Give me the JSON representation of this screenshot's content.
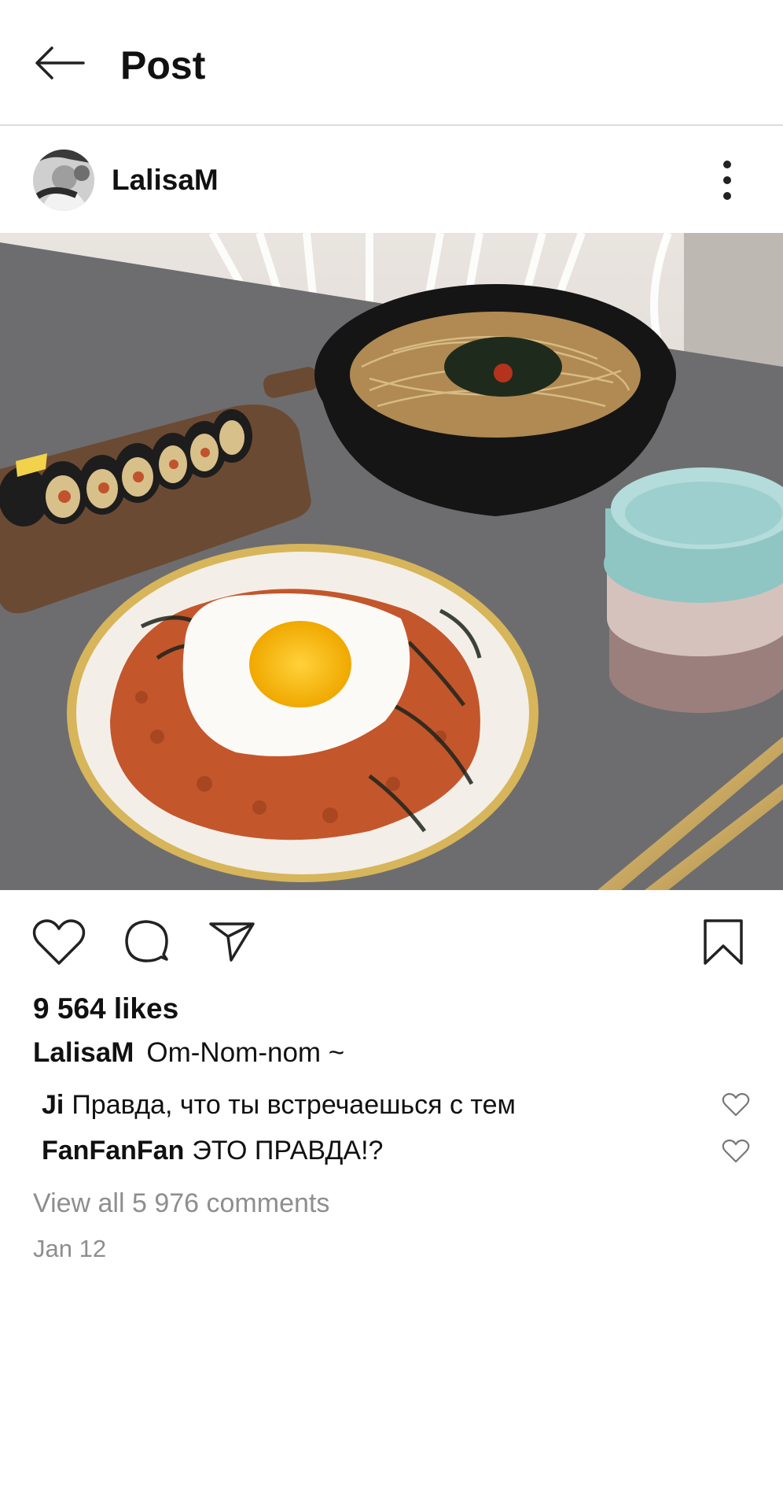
{
  "header": {
    "title": "Post",
    "back_icon": "arrow-left-icon"
  },
  "post": {
    "username": "LalisaM",
    "more_icon": "more-vertical-icon",
    "image_alt": "Kimbap, noodle soup, kimchi fried rice with fried egg, bowls and gold chopsticks on a grey table",
    "likes": "9 564 likes",
    "caption": {
      "user": "LalisaM",
      "text": "Om-Nom-nom ~"
    },
    "comments": [
      {
        "user": "Ji",
        "text": "Правда, что ты встречаешься с тем",
        "like_icon": "heart-outline-icon"
      },
      {
        "user": "FanFanFan",
        "text": "ЭТО ПРАВДА!?",
        "like_icon": "heart-outline-icon"
      }
    ],
    "view_all": "View all 5 976 comments",
    "date": "Jan 12"
  },
  "actions": {
    "like_icon": "heart-outline-icon",
    "comment_icon": "comment-bubble-icon",
    "share_icon": "paper-plane-icon",
    "save_icon": "bookmark-outline-icon"
  }
}
